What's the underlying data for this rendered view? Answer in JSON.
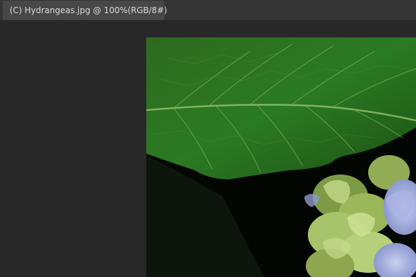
{
  "document_tab": {
    "title": "(C) Hydrangeas.jpg @ 100%(RGB/8#)",
    "close_glyph": "×"
  },
  "canvas": {
    "background_color": "#282828",
    "image_subject": "hydrangea-photo"
  },
  "colors": {
    "tab_active": "#474747",
    "tabbar": "#353535",
    "tab_text": "#dcdcdc"
  }
}
